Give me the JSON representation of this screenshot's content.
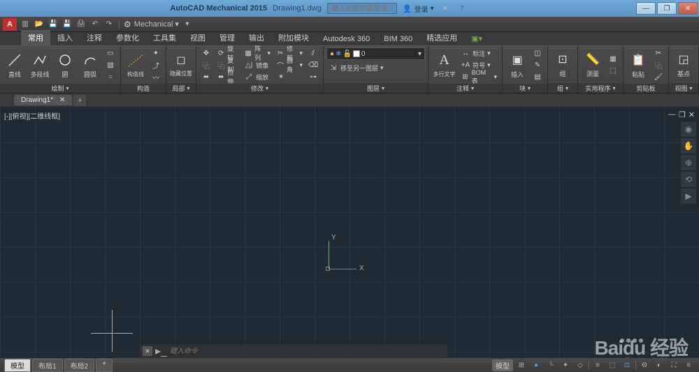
{
  "titlebar": {
    "app_title": "AutoCAD Mechanical 2015",
    "file_name": "Drawing1.dwg",
    "search_placeholder": "键入关键字或短语",
    "login_text": "登录"
  },
  "qat": {
    "workspace": "Mechanical"
  },
  "menu_tabs": [
    "常用",
    "插入",
    "注释",
    "参数化",
    "工具集",
    "视图",
    "管理",
    "输出",
    "附加模块",
    "Autodesk 360",
    "BIM 360",
    "精选应用"
  ],
  "ribbon": {
    "panels": [
      {
        "title": "绘制",
        "tools": [
          {
            "label": "直线",
            "icon": "line"
          },
          {
            "label": "多段线",
            "icon": "polyline"
          },
          {
            "label": "圆",
            "icon": "circle"
          },
          {
            "label": "圆弧",
            "icon": "arc"
          }
        ]
      },
      {
        "title": "构造",
        "tools": [
          {
            "label": "构造线",
            "icon": "construction"
          }
        ]
      },
      {
        "title": "局部",
        "tools": [
          {
            "label": "隐藏位置",
            "icon": "hide"
          }
        ]
      },
      {
        "title": "修改",
        "small_rows": [
          [
            {
              "label": "旋转",
              "icon": "⟳"
            },
            {
              "label": "阵列",
              "icon": "▦"
            }
          ],
          [
            {
              "label": "复制",
              "icon": "⿻"
            },
            {
              "label": "镜像",
              "icon": "△|"
            }
          ],
          [
            {
              "label": "拉伸",
              "icon": "⬌"
            },
            {
              "label": "缩放",
              "icon": "⤢"
            }
          ]
        ],
        "small_rows2": [
          [
            {
              "label": "修剪",
              "icon": "✂"
            }
          ],
          [
            {
              "label": "圆角",
              "icon": "⌒"
            }
          ]
        ]
      },
      {
        "title": "图层",
        "layer_current": "0",
        "move_to": "移至另一图层"
      },
      {
        "title": "注释",
        "tools": [
          {
            "label": "多行文字",
            "icon": "A"
          }
        ],
        "small_rows": [
          [
            {
              "label": "标注",
              "icon": "↔"
            }
          ],
          [
            {
              "label": "符号",
              "icon": "+A"
            }
          ],
          [
            {
              "label": "BOM 表",
              "icon": "⊞"
            }
          ]
        ]
      },
      {
        "title": "块",
        "tools": [
          {
            "label": "插入",
            "icon": "block"
          }
        ]
      },
      {
        "title": "组",
        "tools": [
          {
            "label": "组",
            "icon": "group"
          }
        ]
      },
      {
        "title": "实用程序",
        "tools": [
          {
            "label": "测量",
            "icon": "measure"
          }
        ]
      },
      {
        "title": "剪贴板",
        "tools": [
          {
            "label": "粘贴",
            "icon": "paste"
          }
        ]
      },
      {
        "title": "视图",
        "tools": [
          {
            "label": "基点",
            "icon": "base"
          }
        ]
      }
    ]
  },
  "file_tabs": [
    "Drawing1*"
  ],
  "viewport": {
    "label": "[-][俯视][二维线框]",
    "x": "X",
    "y": "Y"
  },
  "command": {
    "placeholder": "键入命令"
  },
  "status": {
    "tabs": [
      "模型",
      "布局1",
      "布局2"
    ],
    "model_label": "模型"
  },
  "watermark": {
    "main": "Baidu 经验",
    "sub": "jingyan.baidu.com"
  }
}
